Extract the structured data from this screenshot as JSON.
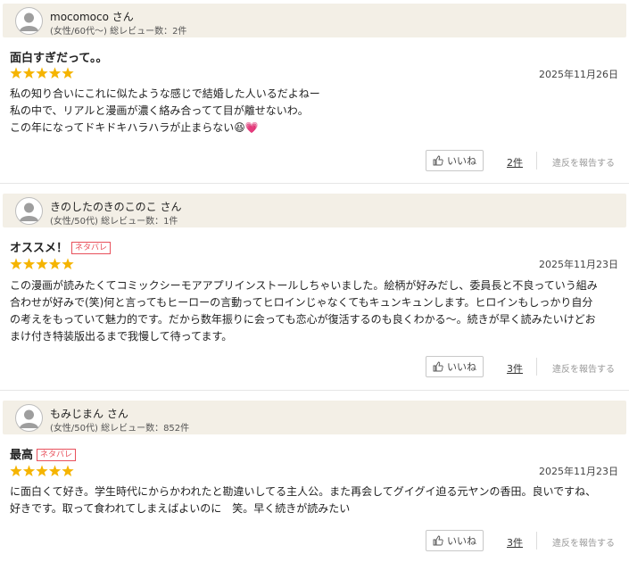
{
  "reviews": [
    {
      "name": "mocomoco さん",
      "meta": "(女性/60代〜)  総レビュー数：2件",
      "title": "面白すぎだって。。",
      "spoiler": "",
      "rating": 5,
      "date": "2025年11月26日",
      "lines": [
        "私の知り合いにこれに似たような感じで結婚した人いるだよねー",
        "私の中で、リアルと漫画が濃く絡み合ってて目が離せないわ。",
        "この年になってドキドキハラハラが止まらない😆💗"
      ],
      "like_label": "いいね",
      "count": "2件",
      "report": "違反を報告する"
    },
    {
      "name": "きのしたのきのこのこ さん",
      "meta": "(女性/50代)  総レビュー数：1件",
      "title": "オススメ！",
      "spoiler": "ネタバレ",
      "rating": 5,
      "date": "2025年11月23日",
      "lines": [
        "この漫画が読みたくてコミックシーモアアプリインストールしちゃいました。絵柄が好みだし、委員長と不良っていう組み",
        "合わせが好みで(笑)何と言ってもヒーローの言動ってヒロインじゃなくてもキュンキュンします。ヒロインもしっかり自分",
        "の考えをもっていて魅力的です。だから数年振りに会っても恋心が復活するのも良くわかる〜。続きが早く読みたいけどお",
        "まけ付き特装版出るまで我慢して待ってます。"
      ],
      "like_label": "いいね",
      "count": "3件",
      "report": "違反を報告する"
    },
    {
      "name": "もみじまん さん",
      "meta": "(女性/50代)  総レビュー数：852件",
      "title": "最高",
      "spoiler": "ネタバレ",
      "rating": 5,
      "date": "2025年11月23日",
      "lines": [
        "に面白くて好き。学生時代にからかわれたと勘違いしてる主人公。また再会してグイグイ迫る元ヤンの香田。良いですね、",
        "好きです。取って食われてしまえばよいのに　笑。早く続きが読みたい"
      ],
      "like_label": "いいね",
      "count": "3件",
      "report": "違反を報告する"
    }
  ],
  "colors": {
    "star": "#f5b400",
    "header_bg": "#f3efe6",
    "spoiler": "#e8505b"
  },
  "icons": {
    "like": "thumbs-up-icon",
    "avatar": "user-avatar-icon",
    "star": "star-icon"
  }
}
